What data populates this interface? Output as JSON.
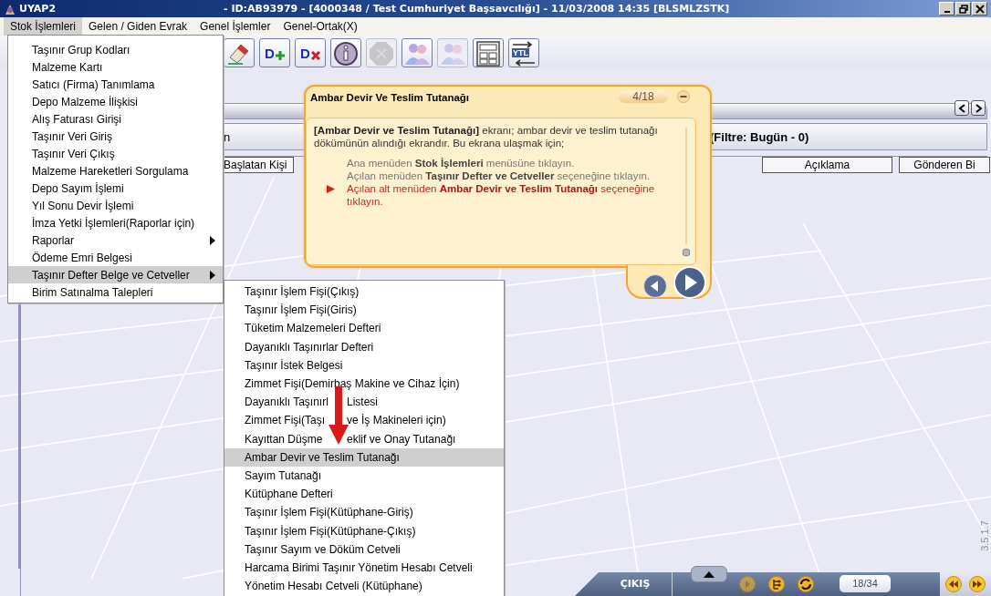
{
  "window": {
    "app_name": "UYAP2",
    "title": "- ID:AB93979 - [4000348 / Test Cumhuriyet Başsavcılığı] - 11/03/2008 14:35 [BLSMLZSTK]"
  },
  "menu_bar": [
    {
      "label": "Stok İşlemleri",
      "selected": true
    },
    {
      "label": "Gelen / Giden Evrak",
      "selected": false
    },
    {
      "label": "Genel İşlemler",
      "selected": false
    },
    {
      "label": "Genel-Ortak(X)",
      "selected": false
    }
  ],
  "toolbar": [
    {
      "kind": "eraser",
      "disabled": false
    },
    {
      "kind": "add",
      "label": "D",
      "disabled": false
    },
    {
      "kind": "delete",
      "label": "D",
      "disabled": false
    },
    {
      "kind": "info",
      "disabled": false
    },
    {
      "kind": "stop",
      "disabled": true
    },
    {
      "kind": "users",
      "disabled": false
    },
    {
      "kind": "users",
      "disabled": true
    },
    {
      "kind": "calculator",
      "disabled": false
    },
    {
      "kind": "currency",
      "label": "YTL",
      "disabled": false
    }
  ],
  "panel": {
    "title": "n",
    "filter": "(Filtre: Bugün - 0)",
    "columns": [
      "Başlatan Kişi",
      "Açıklama",
      "Gönderen Bi"
    ]
  },
  "menu": {
    "items": [
      {
        "label": "Taşınır Grup Kodları",
        "has_submenu": false,
        "selected": false
      },
      {
        "label": "Malzeme Kartı",
        "has_submenu": false,
        "selected": false
      },
      {
        "label": "Satıcı (Firma) Tanımlama",
        "has_submenu": false,
        "selected": false
      },
      {
        "label": "Depo Malzeme İlişkisi",
        "has_submenu": false,
        "selected": false
      },
      {
        "label": "Alış Faturası Girişi",
        "has_submenu": false,
        "selected": false
      },
      {
        "label": "Taşınır Veri Giriş",
        "has_submenu": false,
        "selected": false
      },
      {
        "label": "Taşınır Veri Çıkış",
        "has_submenu": false,
        "selected": false
      },
      {
        "label": "Malzeme Hareketleri Sorgulama",
        "has_submenu": false,
        "selected": false
      },
      {
        "label": "Depo Sayım İşlemi",
        "has_submenu": false,
        "selected": false
      },
      {
        "label": "Yıl Sonu Devir İşlemi",
        "has_submenu": false,
        "selected": false
      },
      {
        "label": "İmza Yetki İşlemleri(Raporlar için)",
        "has_submenu": false,
        "selected": false
      },
      {
        "label": "Raporlar",
        "has_submenu": true,
        "selected": false
      },
      {
        "label": "Ödeme Emri Belgesi",
        "has_submenu": false,
        "selected": false
      },
      {
        "label": "Taşınır Defter Belge ve Cetveller",
        "has_submenu": true,
        "selected": true
      },
      {
        "label": "Birim Satınalma Talepleri",
        "has_submenu": false,
        "selected": false
      }
    ]
  },
  "submenu": {
    "items": [
      {
        "label": "Taşınır İşlem Fişi(Çıkış)",
        "has_submenu": false,
        "selected": false
      },
      {
        "label": "Taşınır İşlem Fişi(Giris)",
        "has_submenu": false,
        "selected": false
      },
      {
        "label": "Tüketim Malzemeleri Defteri",
        "has_submenu": false,
        "selected": false
      },
      {
        "label": "Dayanıklı Taşınırlar Defteri",
        "has_submenu": false,
        "selected": false
      },
      {
        "label": "Taşınır İstek Belgesi",
        "has_submenu": false,
        "selected": false
      },
      {
        "label": "Zimmet Fişi(Demirbaş Makine ve Cihaz İçin)",
        "has_submenu": false,
        "selected": false
      },
      {
        "label_parts": [
          "Dayanıklı Taşınırl",
          "Listesi"
        ],
        "has_submenu": false,
        "selected": false
      },
      {
        "label_parts": [
          "Zimmet Fişi(Taşı",
          "ve İş Makineleri için)"
        ],
        "has_submenu": false,
        "selected": false
      },
      {
        "label_parts": [
          "Kayıttan Düşme",
          "eklif ve Onay Tutanağı"
        ],
        "has_submenu": false,
        "selected": false
      },
      {
        "label": "Ambar Devir ve Teslim Tutanağı",
        "has_submenu": false,
        "selected": true
      },
      {
        "label": "Sayım Tutanağı",
        "has_submenu": false,
        "selected": false
      },
      {
        "label": "Kütüphane Defteri",
        "has_submenu": false,
        "selected": false
      },
      {
        "label": "Taşınır İşlem Fişi(Kütüphane-Giriş)",
        "has_submenu": false,
        "selected": false
      },
      {
        "label": "Taşınır İşlem Fişi(Kütüphane-Çıkış)",
        "has_submenu": false,
        "selected": false
      },
      {
        "label": "Taşınır Sayım ve Döküm Cetveli",
        "has_submenu": false,
        "selected": false
      },
      {
        "label": "Harcama Birimi Taşınır Yönetim Hesabı Cetveli",
        "has_submenu": false,
        "selected": false
      },
      {
        "label": "Yönetim Hesabı Cetveli (Kütüphane)",
        "has_submenu": false,
        "selected": false
      }
    ]
  },
  "help_popup": {
    "title": "Ambar Devir Ve Teslim Tutanağı",
    "counter": "4/18",
    "intro": "**[Ambar Devir ve Teslim Tutanağı]** ekranı; ambar devir ve teslim tutanağı dökümünün alındığı ekrandır. Bu ekrana ulaşmak için;",
    "steps": [
      {
        "text": "Ana menüden **Stok İşlemleri** menüsüne tıklayın.",
        "current": false
      },
      {
        "text": "Açılan menüden **Taşınır Defter ve Cetveller** seçeneğine tıklayın.",
        "current": false
      },
      {
        "text": "Açılan alt menüden **Ambar Devir ve Teslim Tutanağı** seçeneğine tıklayın.",
        "current": true
      }
    ]
  },
  "bottom_bar": {
    "exit": "ÇIKIŞ",
    "page": "18/34"
  },
  "version": "3.5.1.7"
}
